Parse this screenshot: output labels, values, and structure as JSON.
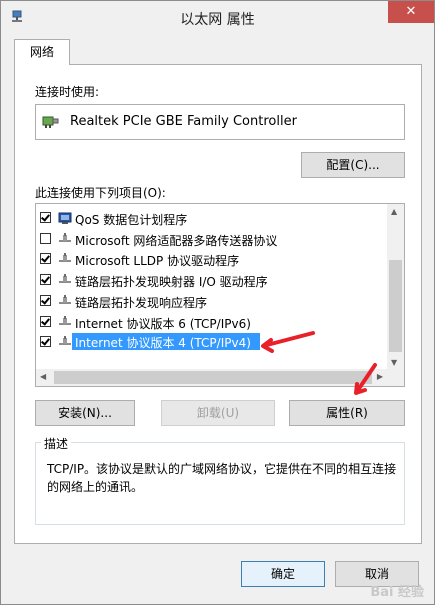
{
  "window": {
    "title": "以太网 属性",
    "close_label": "✕"
  },
  "tab": {
    "label": "网络"
  },
  "connect_using": {
    "label": "连接时使用:",
    "adapter_name": "Realtek PCIe GBE Family Controller",
    "configure_label": "配置(C)..."
  },
  "items_section": {
    "label": "此连接使用下列项目(O):",
    "items": [
      {
        "label": "QoS 数据包计划程序",
        "checked": true,
        "icon": "qos-icon"
      },
      {
        "label": "Microsoft 网络适配器多路传送器协议",
        "checked": false,
        "icon": "protocol-icon"
      },
      {
        "label": "Microsoft LLDP 协议驱动程序",
        "checked": true,
        "icon": "protocol-icon"
      },
      {
        "label": "链路层拓扑发现映射器 I/O 驱动程序",
        "checked": true,
        "icon": "protocol-icon"
      },
      {
        "label": "链路层拓扑发现响应程序",
        "checked": true,
        "icon": "protocol-icon"
      },
      {
        "label": "Internet 协议版本 6 (TCP/IPv6)",
        "checked": true,
        "icon": "protocol-icon"
      },
      {
        "label": "Internet 协议版本 4 (TCP/IPv4)",
        "checked": true,
        "icon": "protocol-icon",
        "selected": true
      }
    ]
  },
  "buttons": {
    "install": "安装(N)...",
    "uninstall": "卸载(U)",
    "properties": "属性(R)",
    "ok": "确定",
    "cancel": "取消"
  },
  "description": {
    "label": "描述",
    "text": "TCP/IP。该协议是默认的广域网络协议，它提供在不同的相互连接的网络上的通讯。"
  },
  "watermark": "Bai 经验",
  "colors": {
    "selection": "#3399ff",
    "annotation_arrow": "#e8202a",
    "close_button": "#c7504c"
  }
}
